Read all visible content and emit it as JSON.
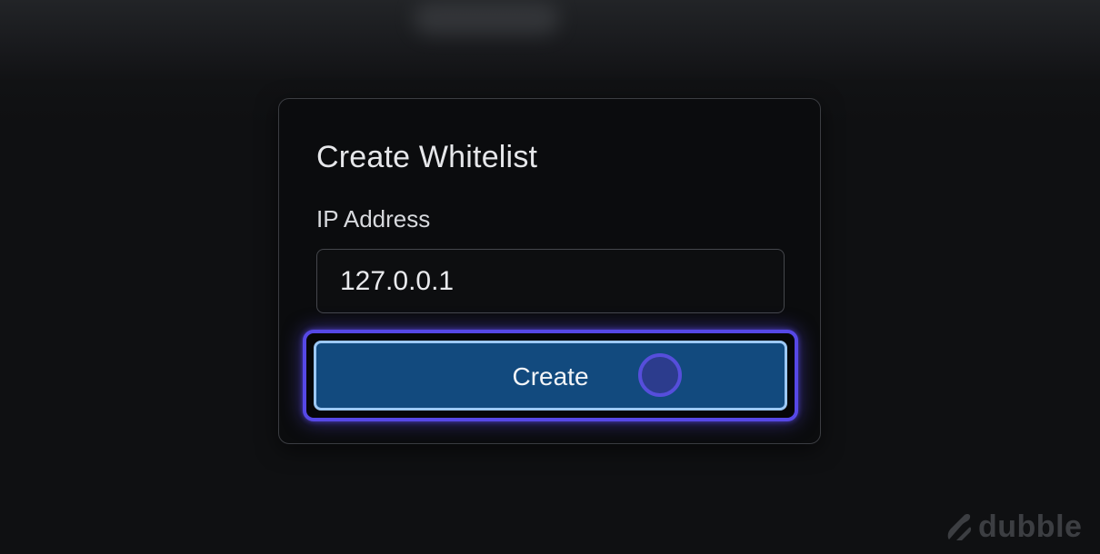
{
  "dialog": {
    "title": "Create Whitelist",
    "ip_label": "IP Address",
    "ip_value": "127.0.0.1",
    "create_label": "Create"
  },
  "watermark": {
    "text": "dubble",
    "icon": "dubble-logo-icon"
  },
  "colors": {
    "background": "#0f1012",
    "card": "#0b0c0e",
    "button": "#124a7e",
    "button_border": "#9cc8f5",
    "focus_ring": "#5648e6"
  }
}
